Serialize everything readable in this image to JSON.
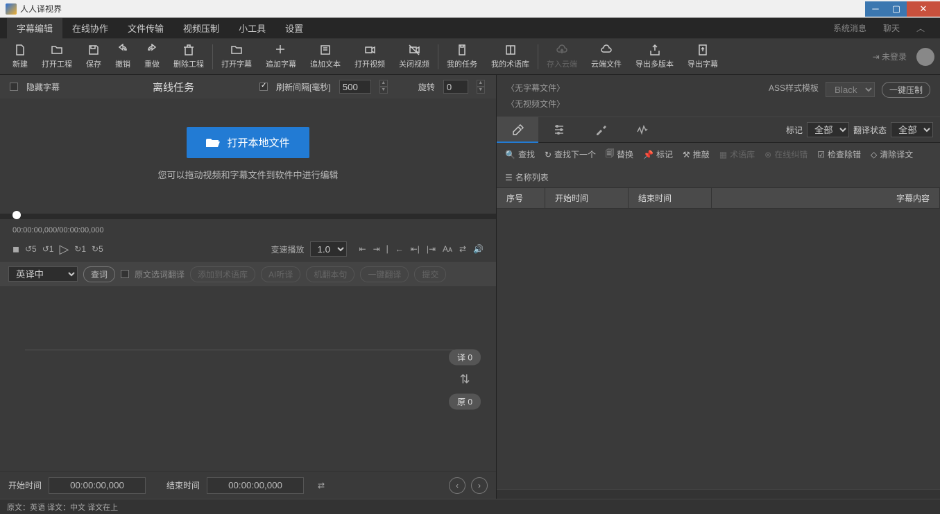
{
  "title": "人人译视界",
  "menus": [
    "字幕编辑",
    "在线协作",
    "文件传输",
    "视频压制",
    "小工具",
    "设置"
  ],
  "menuRight": {
    "sysMsg": "系统消息",
    "chat": "聊天"
  },
  "tools": [
    {
      "label": "新建",
      "icon": "file"
    },
    {
      "label": "打开工程",
      "icon": "folder"
    },
    {
      "label": "保存",
      "icon": "save"
    },
    {
      "label": "撤销",
      "icon": "undo"
    },
    {
      "label": "重做",
      "icon": "redo"
    },
    {
      "label": "删除工程",
      "icon": "trash"
    },
    {
      "label": "打开字幕",
      "icon": "folder2"
    },
    {
      "label": "追加字幕",
      "icon": "plus"
    },
    {
      "label": "追加文本",
      "icon": "text"
    },
    {
      "label": "打开视频",
      "icon": "video"
    },
    {
      "label": "关闭视频",
      "icon": "videoff"
    },
    {
      "label": "我的任务",
      "icon": "clip"
    },
    {
      "label": "我的术语库",
      "icon": "book"
    },
    {
      "label": "存入云端",
      "icon": "cloudup",
      "disabled": true
    },
    {
      "label": "云端文件",
      "icon": "cloud"
    },
    {
      "label": "导出多版本",
      "icon": "export"
    },
    {
      "label": "导出字幕",
      "icon": "exportsub"
    }
  ],
  "login": "未登录",
  "videoHeader": {
    "hideSub": "隐藏字幕",
    "offline": "离线任务",
    "refresh": "刷新间隔[毫秒]",
    "refreshVal": "500",
    "rotate": "旋转",
    "rotateVal": "0"
  },
  "dropArea": {
    "open": "打开本地文件",
    "hint": "您可以拖动视频和字幕文件到软件中进行编辑"
  },
  "timecode": "00:00:00,000/00:00:00,000",
  "speed": {
    "label": "变速播放",
    "val": "1.0"
  },
  "trans": {
    "dir": "英译中",
    "lookup": "查词",
    "srcWord": "原文选词翻译",
    "addTerm": "添加到术语库",
    "aiListen": "AI听译",
    "machine": "机翻本句",
    "oneKey": "一键翻译",
    "submit": "提交"
  },
  "badges": {
    "yi": "译 0",
    "yuan": "原 0"
  },
  "timeRow": {
    "start": "开始时间",
    "startVal": "00:00:00,000",
    "end": "结束时间",
    "endVal": "00:00:00,000"
  },
  "right": {
    "noSub": "〈无字幕文件〉",
    "noVideo": "〈无视频文件〉",
    "assLabel": "ASS样式模板",
    "assVal": "Black",
    "compress": "一键压制",
    "mark": "标记",
    "all": "全部",
    "transStatus": "翻译状态"
  },
  "actions": {
    "find": "查找",
    "findNext": "查找下一个",
    "replace": "替换",
    "markA": "标记",
    "push": "推敲",
    "term": "术语库",
    "correct": "在线纠错",
    "check": "检查除错",
    "clear": "清除译文",
    "namelist": "名称列表"
  },
  "tableHeaders": {
    "seq": "序号",
    "start": "开始时间",
    "end": "结束时间",
    "content": "字幕内容"
  },
  "status": "原文：英语 译文：中文  译文在上"
}
